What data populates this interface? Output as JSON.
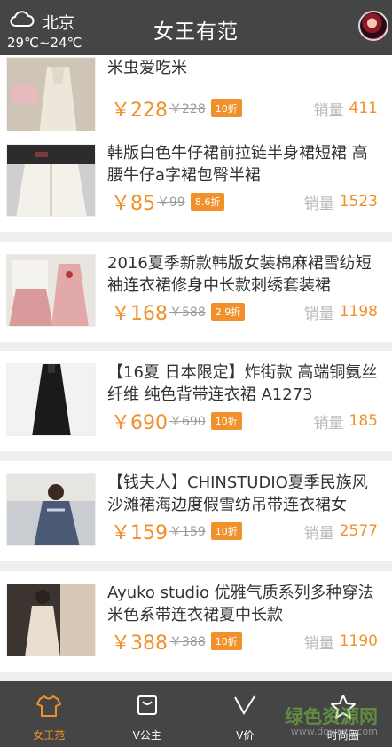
{
  "header": {
    "city": "北京",
    "temperature": "29℃~24℃",
    "title": "女王有范",
    "weather_icon": "cloud-icon"
  },
  "products": [
    {
      "title": "米虫爱吃米",
      "price": "￥228",
      "original_price": "￥228",
      "discount": "10折",
      "sales_label": "销量",
      "sales": "411"
    },
    {
      "title": "韩版白色牛仔裙前拉链半身裙短裙 高腰牛仔a字裙包臀半裙",
      "price": "￥85",
      "original_price": "￥99",
      "discount": "8.6折",
      "sales_label": "销量",
      "sales": "1523"
    },
    {
      "title": "2016夏季新款韩版女装棉麻裙雪纺短袖连衣裙修身中长款刺绣套装裙",
      "price": "￥168",
      "original_price": "￥588",
      "discount": "2.9折",
      "sales_label": "销量",
      "sales": "1198"
    },
    {
      "title": "【16夏 日本限定】炸街款 高端铜氨丝纤维 纯色背带连衣裙 A1273",
      "price": "￥690",
      "original_price": "￥690",
      "discount": "10折",
      "sales_label": "销量",
      "sales": "185"
    },
    {
      "title": "【钱夫人】CHINSTUDIO夏季民族风沙滩裙海边度假雪纺吊带连衣裙女",
      "price": "￥159",
      "original_price": "￥159",
      "discount": "10折",
      "sales_label": "销量",
      "sales": "2577"
    },
    {
      "title": "Ayuko studio 优雅气质系列多种穿法 米色系带连衣裙夏中长款",
      "price": "￥388",
      "original_price": "￥388",
      "discount": "10折",
      "sales_label": "销量",
      "sales": "1190"
    }
  ],
  "nav": [
    {
      "label": "女王范",
      "icon": "tshirt-icon",
      "active": true
    },
    {
      "label": "V公主",
      "icon": "bag-icon",
      "active": false
    },
    {
      "label": "V价",
      "icon": "v-icon",
      "active": false
    },
    {
      "label": "时尚圈",
      "icon": "star-icon",
      "active": false
    }
  ],
  "watermark": {
    "line1": "绿色资源网",
    "line2": "www.downcc.com"
  },
  "colors": {
    "header_bg": "#454545",
    "accent": "#f0912b",
    "nav_bg": "#454545"
  }
}
